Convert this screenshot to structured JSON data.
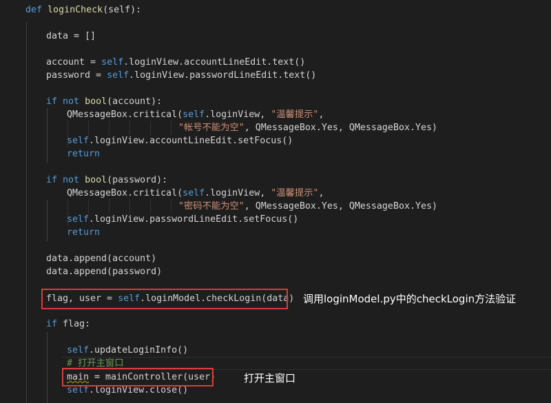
{
  "code": {
    "def_line": {
      "kw": "def",
      "fn": "loginCheck",
      "rest": "(self):"
    },
    "data_init": "data = []",
    "account_line": {
      "lhs": "account = ",
      "self": "self",
      "rest": ".loginView.accountLineEdit.text()"
    },
    "password_line": {
      "lhs": "password = ",
      "self": "self",
      "rest": ".loginView.passwordLineEdit.text()"
    },
    "if_account": {
      "kw": "if not",
      "fn": "bool",
      "rest": "(account):"
    },
    "msg1_a": {
      "pre": "QMessageBox.critical(",
      "self": "self",
      "mid": ".loginView, ",
      "str": "\"温馨提示\"",
      "end": ","
    },
    "msg1_b": {
      "str": "\"帐号不能为空\"",
      "rest": ", QMessageBox.Yes, QMessageBox.Yes)"
    },
    "focus1": {
      "self": "self",
      "rest": ".loginView.accountLineEdit.setFocus()"
    },
    "return1": "return",
    "if_password": {
      "kw": "if not",
      "fn": "bool",
      "rest": "(password):"
    },
    "msg2_a": {
      "pre": "QMessageBox.critical(",
      "self": "self",
      "mid": ".loginView, ",
      "str": "\"温馨提示\"",
      "end": ","
    },
    "msg2_b": {
      "str": "\"密码不能为空\"",
      "rest": ", QMessageBox.Yes, QMessageBox.Yes)"
    },
    "focus2": {
      "self": "self",
      "rest": ".loginView.passwordLineEdit.setFocus()"
    },
    "return2": "return",
    "append_account": "data.append(account)",
    "append_password": "data.append(password)",
    "flag_line": {
      "lhs": "flag, user = ",
      "self": "self",
      "rest": ".loginModel.checkLogin(data)"
    },
    "if_flag": {
      "kw": "if",
      "rest": " flag:"
    },
    "update_line": {
      "self": "self",
      "rest": ".updateLoginInfo()"
    },
    "comment_line": "# 打开主窗口",
    "main_line": {
      "var": "main",
      "rest": " = mainController(user)"
    },
    "close_line": {
      "self": "self",
      "rest": ".loginView.close()"
    }
  },
  "annotations": {
    "check_login": "调用loginModel.py中的checkLogin方法验证",
    "open_window": "打开主窗口"
  },
  "colors": {
    "background": "#1e1e1e",
    "keyword": "#569cd6",
    "function": "#dcdcaa",
    "string": "#ce9178",
    "comment": "#6a9955",
    "text": "#d4d4d4",
    "highlight_box": "#e03a3a"
  }
}
